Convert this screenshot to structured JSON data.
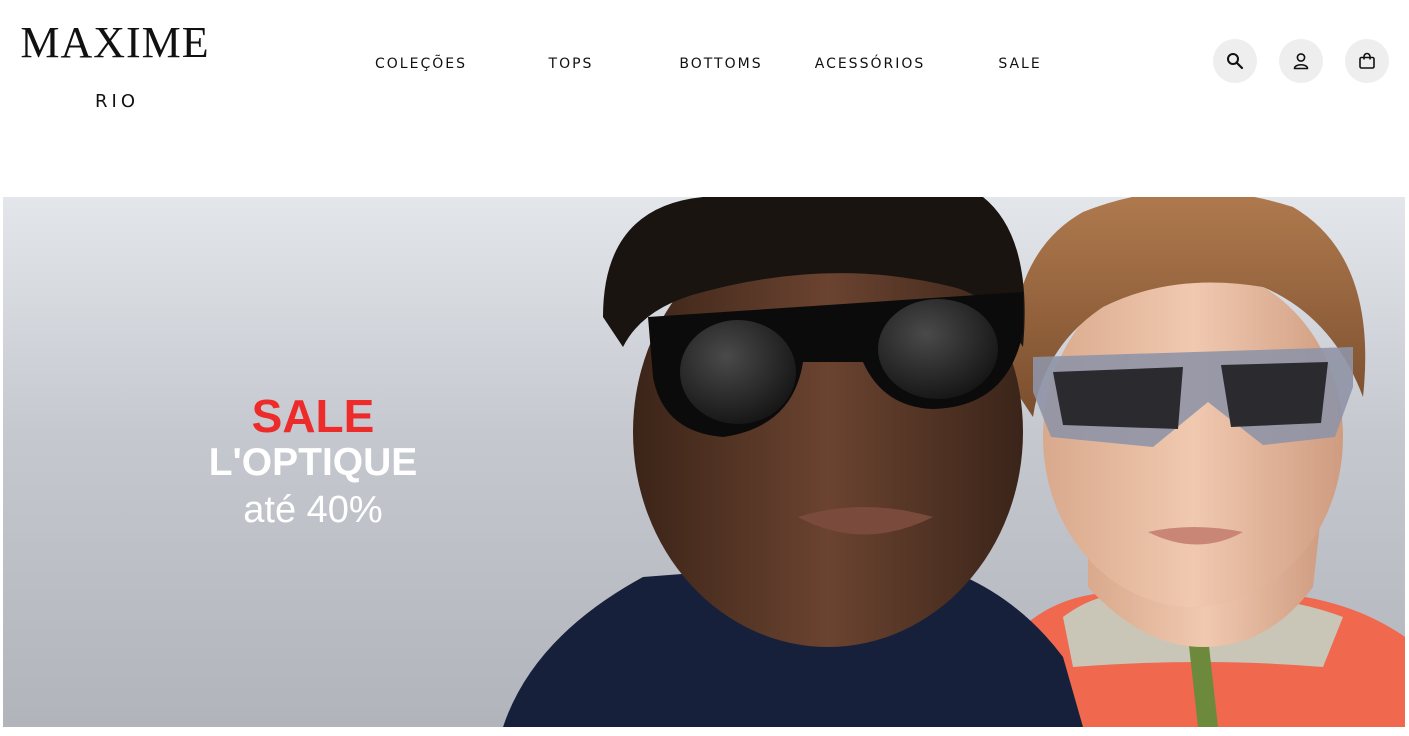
{
  "brand": {
    "name": "MAXIME",
    "city": "RIO"
  },
  "nav": {
    "items": [
      {
        "label": "COLEÇÕES"
      },
      {
        "label": "TOPS"
      },
      {
        "label": "BOTTOMS"
      },
      {
        "label": "ACESSÓRIOS"
      },
      {
        "label": "SALE"
      }
    ]
  },
  "header_actions": {
    "search": {
      "icon": "search-icon"
    },
    "account": {
      "icon": "user-icon"
    },
    "cart": {
      "icon": "shopping-bag-icon"
    }
  },
  "hero": {
    "sale_label": "SALE",
    "title": "L'OPTIQUE",
    "discount": "até 40%",
    "colors": {
      "sale": "#ee2b2b",
      "text": "#ffffff",
      "background": "#c5c8cf"
    }
  }
}
